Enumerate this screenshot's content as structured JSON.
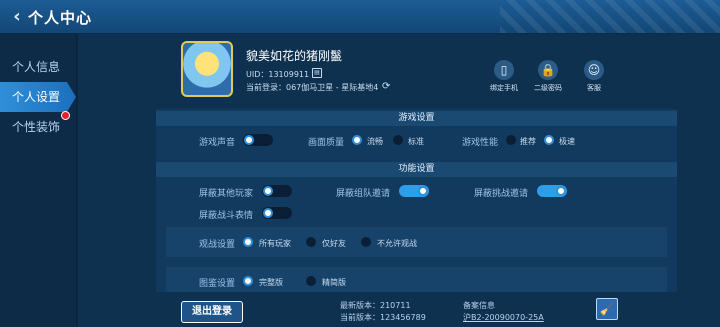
{
  "header": {
    "back_glyph": "‹",
    "title": "个人中心"
  },
  "sidebar": {
    "items": [
      {
        "label": "个人信息"
      },
      {
        "label": "个人设置"
      },
      {
        "label": "个性装饰"
      }
    ],
    "active_index": 1,
    "accent": "#2f8fd8",
    "badge_color": "#e3232c"
  },
  "profile": {
    "nickname": "貌美如花的猪刚鬣",
    "uid": "UID：13109911",
    "copy_glyph": "▤",
    "last_login": "当前登录：067伽马卫星 - 星际基地4",
    "refresh_glyph": "⟳"
  },
  "account_buttons": [
    {
      "icon": "phone-icon",
      "glyph": "▯",
      "label": "绑定手机"
    },
    {
      "icon": "lock-icon",
      "glyph": "🔒",
      "label": "二级密码"
    },
    {
      "icon": "support-icon",
      "glyph": "☺",
      "label": "客服"
    }
  ],
  "game_settings": {
    "title": "游戏设置",
    "sound_label": "游戏声音",
    "sound_on": true,
    "quality_label": "画面质量",
    "quality_options": [
      "流畅",
      "标准"
    ],
    "quality_selected": 0,
    "performance_label": "游戏性能",
    "performance_options": [
      "推荐",
      "极速"
    ],
    "performance_selected": 1
  },
  "function_settings": {
    "title": "功能设置",
    "block_players_label": "屏蔽其他玩家",
    "block_players_on": false,
    "block_team_invite_label": "屏蔽组队邀请",
    "block_team_invite_on": true,
    "block_challenge_label": "屏蔽挑战邀请",
    "block_challenge_on": true,
    "block_emotes_label": "屏蔽战斗表情",
    "block_emotes_on": false
  },
  "spectate": {
    "label": "观战设置",
    "options": [
      "所有玩家",
      "仅好友",
      "不允许观战"
    ],
    "selected": 0
  },
  "partial_row": {
    "label": "图鉴设置",
    "options": [
      "完整版",
      "精简版"
    ]
  },
  "footer": {
    "logout_label": "退出登录",
    "latest_version": "最新版本：210711",
    "current_version": "当前版本：123456789",
    "record_title": "备案信息",
    "record_number": "沪B2-20090070-25A",
    "clean_glyph": "🧹"
  }
}
